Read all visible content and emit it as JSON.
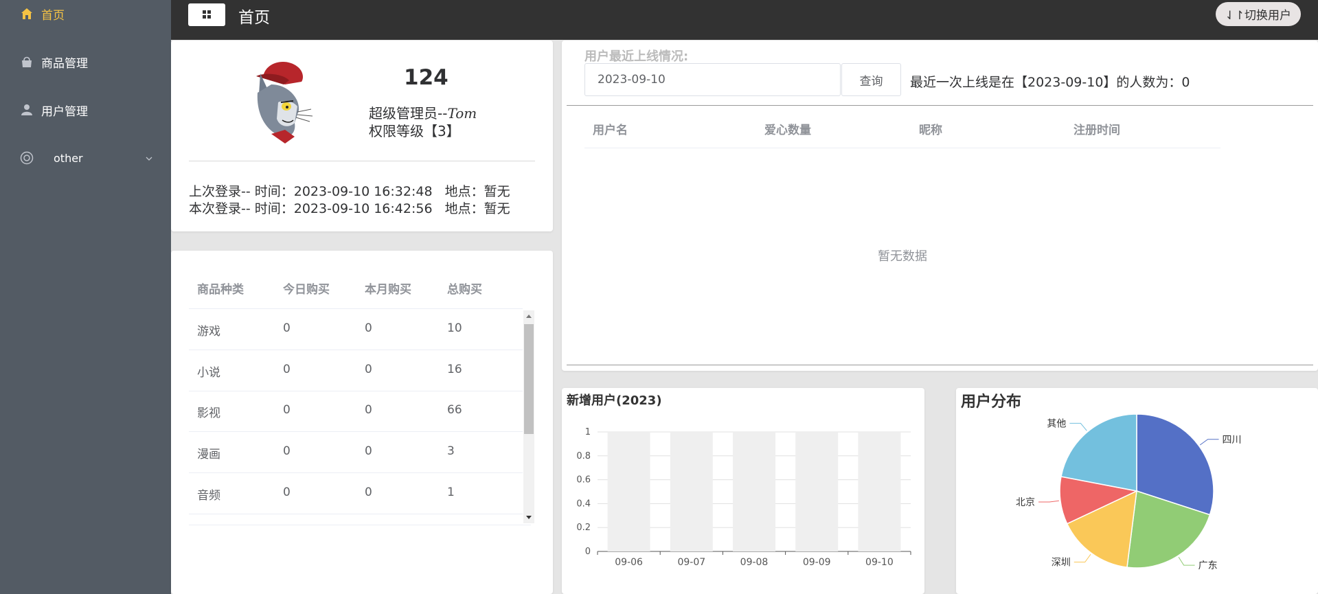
{
  "sidebar": {
    "items": [
      {
        "label": "首页",
        "icon": "home-icon"
      },
      {
        "label": "商品管理",
        "icon": "shopping-bag-icon"
      },
      {
        "label": "用户管理",
        "icon": "user-icon"
      },
      {
        "label": "other",
        "icon": "lifebuoy-icon"
      }
    ],
    "active_color": "#f6c344"
  },
  "header": {
    "title": "首页",
    "switch_user": "⇃↾切换用户"
  },
  "profile": {
    "count": "124",
    "role_prefix": "超级管理员--",
    "username": "Tom",
    "level": "权限等级【3】",
    "last_login": "上次登录-- 时间：2023-09-10 16:32:48   地点：暂无",
    "current_login": "本次登录-- 时间：2023-09-10 16:42:56   地点：暂无"
  },
  "goods_table": {
    "headers": [
      "商品种类",
      "今日购买",
      "本月购买",
      "总购买"
    ],
    "rows": [
      [
        "游戏",
        "0",
        "0",
        "10"
      ],
      [
        "小说",
        "0",
        "0",
        "16"
      ],
      [
        "影视",
        "0",
        "0",
        "66"
      ],
      [
        "漫画",
        "0",
        "0",
        "3"
      ],
      [
        "音频",
        "0",
        "0",
        "1"
      ]
    ]
  },
  "online": {
    "title": "用户最近上线情况:",
    "date_value": "2023-09-10",
    "query_label": "查询",
    "message": "最近一次上线是在【2023-09-10】的人数为：0",
    "headers": [
      "用户名",
      "爱心数量",
      "昵称",
      "注册时间"
    ],
    "empty_text": "暂无数据"
  },
  "chart_data": [
    {
      "type": "bar",
      "title": "新增用户(2023)",
      "categories": [
        "09-06",
        "09-07",
        "09-08",
        "09-09",
        "09-10"
      ],
      "values": [
        0,
        0,
        0,
        0,
        0
      ],
      "ylim": [
        0,
        1
      ],
      "yticks": [
        "0",
        "0.2",
        "0.4",
        "0.6",
        "0.8",
        "1"
      ],
      "grid": true,
      "bar_background": "#efefef"
    },
    {
      "type": "pie",
      "title": "用户分布",
      "labels": [
        "四川",
        "广东",
        "深圳",
        "北京",
        "其他"
      ],
      "values": [
        30,
        22,
        16,
        10,
        22
      ],
      "colors": [
        "#5470c6",
        "#91cc75",
        "#fac858",
        "#ee6666",
        "#73c0de"
      ]
    }
  ]
}
